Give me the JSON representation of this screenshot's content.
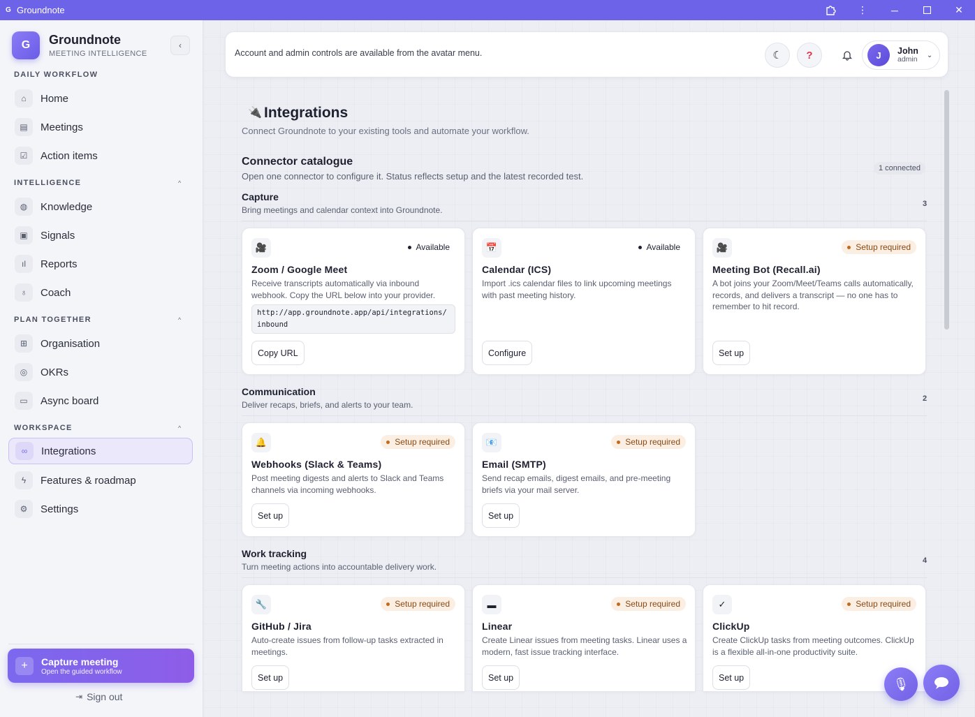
{
  "window": {
    "app_glyph": "G",
    "title": "Groundnote",
    "controls": [
      "extension-icon",
      "more-vertical-icon",
      "minimize-icon",
      "maximize-icon",
      "close-icon"
    ]
  },
  "sidebar": {
    "brand": {
      "logo": "G",
      "name": "Groundnote",
      "subtitle": "MEETING INTELLIGENCE"
    },
    "sections": {
      "daily": "DAILY WORKFLOW",
      "intelligence": "INTELLIGENCE",
      "plan": "PLAN TOGETHER",
      "workspace": "WORKSPACE"
    },
    "items": [
      {
        "label": "Home",
        "icon": "home-icon"
      },
      {
        "label": "Meetings",
        "icon": "document-icon"
      },
      {
        "label": "Action items",
        "icon": "checkbox-icon"
      },
      {
        "label": "Knowledge",
        "icon": "globe-icon"
      },
      {
        "label": "Signals",
        "icon": "cpu-icon"
      },
      {
        "label": "Reports",
        "icon": "bar-chart-icon"
      },
      {
        "label": "Coach",
        "icon": "award-icon"
      },
      {
        "label": "Organisation",
        "icon": "grid-icon"
      },
      {
        "label": "OKRs",
        "icon": "target-icon"
      },
      {
        "label": "Async board",
        "icon": "message-square-icon"
      },
      {
        "label": "Integrations",
        "icon": "link-icon"
      },
      {
        "label": "Features & roadmap",
        "icon": "zap-icon"
      },
      {
        "label": "Settings",
        "icon": "gear-icon"
      }
    ],
    "active_item": "Integrations",
    "capture": {
      "title": "Capture meeting",
      "subtitle": "Open the guided workflow"
    },
    "signout": "Sign out"
  },
  "topbar": {
    "message": "Account and admin controls are available from the avatar menu.",
    "user": {
      "initial": "J",
      "name": "John",
      "role": "admin"
    }
  },
  "page": {
    "title": "Integrations",
    "subtitle": "Connect Groundnote to your existing tools and automate your workflow.",
    "catalogue": {
      "title": "Connector catalogue",
      "subtitle": "Open one connector to configure it. Status reflects setup and the latest recorded test.",
      "badge": "1 connected"
    },
    "groups": [
      {
        "title": "Capture",
        "subtitle": "Bring meetings and calendar context into Groundnote.",
        "count": "3",
        "cards": [
          {
            "icon": "video-camera-icon",
            "glyph": "🎥",
            "status": "Available",
            "status_type": "available",
            "title": "Zoom / Google Meet",
            "desc": "Receive transcripts automatically via inbound webhook. Copy the URL below into your provider.",
            "url": "http://app.groundnote.app/api/integrations/inbound",
            "button": "Copy URL"
          },
          {
            "icon": "calendar-icon",
            "glyph": "📅",
            "status": "Available",
            "status_type": "available",
            "title": "Calendar (ICS)",
            "desc": "Import .ics calendar files to link upcoming meetings with past meeting history.",
            "button": "Configure"
          },
          {
            "icon": "video-camera-icon",
            "glyph": "🎥",
            "status": "Setup required",
            "status_type": "setup",
            "title": "Meeting Bot (Recall.ai)",
            "desc": "A bot joins your Zoom/Meet/Teams calls automatically, records, and delivers a transcript — no one has to remember to hit record.",
            "button": "Set up"
          }
        ]
      },
      {
        "title": "Communication",
        "subtitle": "Deliver recaps, briefs, and alerts to your team.",
        "count": "2",
        "cards": [
          {
            "icon": "bell-icon",
            "glyph": "🔔",
            "status": "Setup required",
            "status_type": "setup",
            "title": "Webhooks (Slack & Teams)",
            "desc": "Post meeting digests and alerts to Slack and Teams channels via incoming webhooks.",
            "button": "Set up"
          },
          {
            "icon": "email-icon",
            "glyph": "📧",
            "status": "Setup required",
            "status_type": "setup",
            "title": "Email (SMTP)",
            "desc": "Send recap emails, digest emails, and pre-meeting briefs via your mail server.",
            "button": "Set up"
          }
        ]
      },
      {
        "title": "Work tracking",
        "subtitle": "Turn meeting actions into accountable delivery work.",
        "count": "4",
        "cards": [
          {
            "icon": "wrench-icon",
            "glyph": "🔧",
            "status": "Setup required",
            "status_type": "setup",
            "title": "GitHub / Jira",
            "desc": "Auto-create issues from follow-up tasks extracted in meetings.",
            "button": "Set up"
          },
          {
            "icon": "square-icon",
            "glyph": "▬",
            "status": "Setup required",
            "status_type": "setup",
            "title": "Linear",
            "desc": "Create Linear issues from meeting tasks. Linear uses a modern, fast issue tracking interface.",
            "button": "Set up"
          },
          {
            "icon": "checkmark-icon",
            "glyph": "✓",
            "status": "Setup required",
            "status_type": "setup",
            "title": "ClickUp",
            "desc": "Create ClickUp tasks from meeting outcomes. ClickUp is a flexible all-in-one productivity suite.",
            "button": "Set up"
          }
        ]
      }
    ]
  },
  "fabs": [
    "microphone-icon",
    "chat-bubble-icon"
  ]
}
